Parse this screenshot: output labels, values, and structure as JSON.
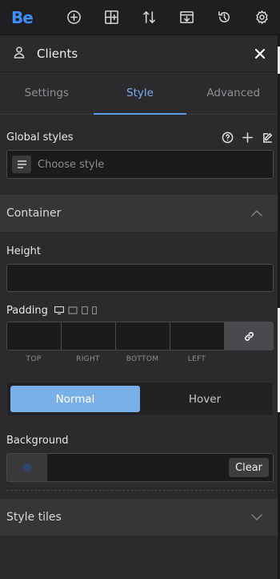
{
  "app": {
    "logo_text": "Be"
  },
  "toolbar": {
    "icons": [
      "add-circle-icon",
      "add-layout-icon",
      "sort-arrows-icon",
      "import-icon",
      "history-icon",
      "settings-gear-icon"
    ]
  },
  "panel": {
    "title": "Clients",
    "icon": "user-icon"
  },
  "tabs": [
    {
      "label": "Settings",
      "active": false
    },
    {
      "label": "Style",
      "active": true
    },
    {
      "label": "Advanced",
      "active": false
    }
  ],
  "global_styles": {
    "label": "Global styles",
    "placeholder": "Choose style"
  },
  "container": {
    "title": "Container",
    "height_label": "Height",
    "padding_label": "Padding",
    "padding_sides": [
      "TOP",
      "RIGHT",
      "BOTTOM",
      "LEFT"
    ],
    "state_normal": "Normal",
    "state_hover": "Hover",
    "background_label": "Background",
    "clear_label": "Clear"
  },
  "style_tiles": {
    "title": "Style tiles"
  },
  "colors": {
    "accent": "#3e8ef7",
    "active_tab": "#7aaef0",
    "normal_button": "#7ab0e8"
  }
}
